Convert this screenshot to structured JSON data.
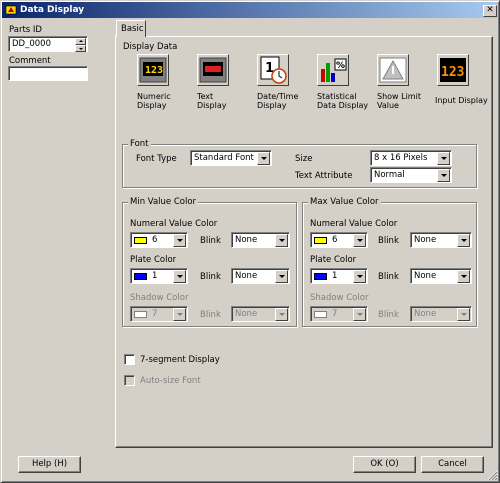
{
  "window": {
    "title": "Data Display",
    "close_glyph": "✕"
  },
  "left": {
    "parts_id_label": "Parts ID",
    "parts_id_value": "DD_0000",
    "comment_label": "Comment",
    "comment_value": ""
  },
  "tabs": [
    {
      "label": "Basic"
    }
  ],
  "display_data": {
    "label": "Display Data",
    "items": [
      {
        "label_line1": "Numeric",
        "label_line2": "Display",
        "icon": "numeric-display-icon"
      },
      {
        "label_line1": "Text",
        "label_line2": "Display",
        "icon": "text-display-icon"
      },
      {
        "label_line1": "Date/Time",
        "label_line2": "Display",
        "icon": "date-time-display-icon"
      },
      {
        "label_line1": "Statistical",
        "label_line2": "Data Display",
        "icon": "statistical-data-display-icon"
      },
      {
        "label_line1": "Show Limit",
        "label_line2": "Value",
        "icon": "show-limit-value-icon"
      },
      {
        "label_line1": "Input Display",
        "label_line2": "",
        "icon": "input-display-icon"
      }
    ]
  },
  "font": {
    "group_label": "Font",
    "type_label": "Font Type",
    "type_value": "Standard Font",
    "size_label": "Size",
    "size_value": "8 x 16 Pixels",
    "attr_label": "Text Attribute",
    "attr_value": "Normal"
  },
  "min_color": {
    "group_label": "Min Value Color",
    "numeral_label": "Numeral Value Color",
    "numeral_value": "6",
    "numeral_color": "#ffff00",
    "numeral_blink": "None",
    "plate_label": "Plate Color",
    "plate_value": "1",
    "plate_color": "#0000ff",
    "plate_blink": "None",
    "shadow_label": "Shadow Color",
    "shadow_value": "7",
    "shadow_color": "#ffffff",
    "shadow_blink": "None",
    "blink_label": "Blink"
  },
  "max_color": {
    "group_label": "Max Value Color",
    "numeral_label": "Numeral Value Color",
    "numeral_value": "6",
    "numeral_color": "#ffff00",
    "numeral_blink": "None",
    "plate_label": "Plate Color",
    "plate_value": "1",
    "plate_color": "#0000ff",
    "plate_blink": "None",
    "shadow_label": "Shadow Color",
    "shadow_value": "7",
    "shadow_color": "#ffffff",
    "shadow_blink": "None",
    "blink_label": "Blink"
  },
  "options": {
    "seven_segment_label": "7-segment Display",
    "auto_size_label": "Auto-size Font"
  },
  "buttons": {
    "help": "Help (H)",
    "ok": "OK (O)",
    "cancel": "Cancel"
  }
}
